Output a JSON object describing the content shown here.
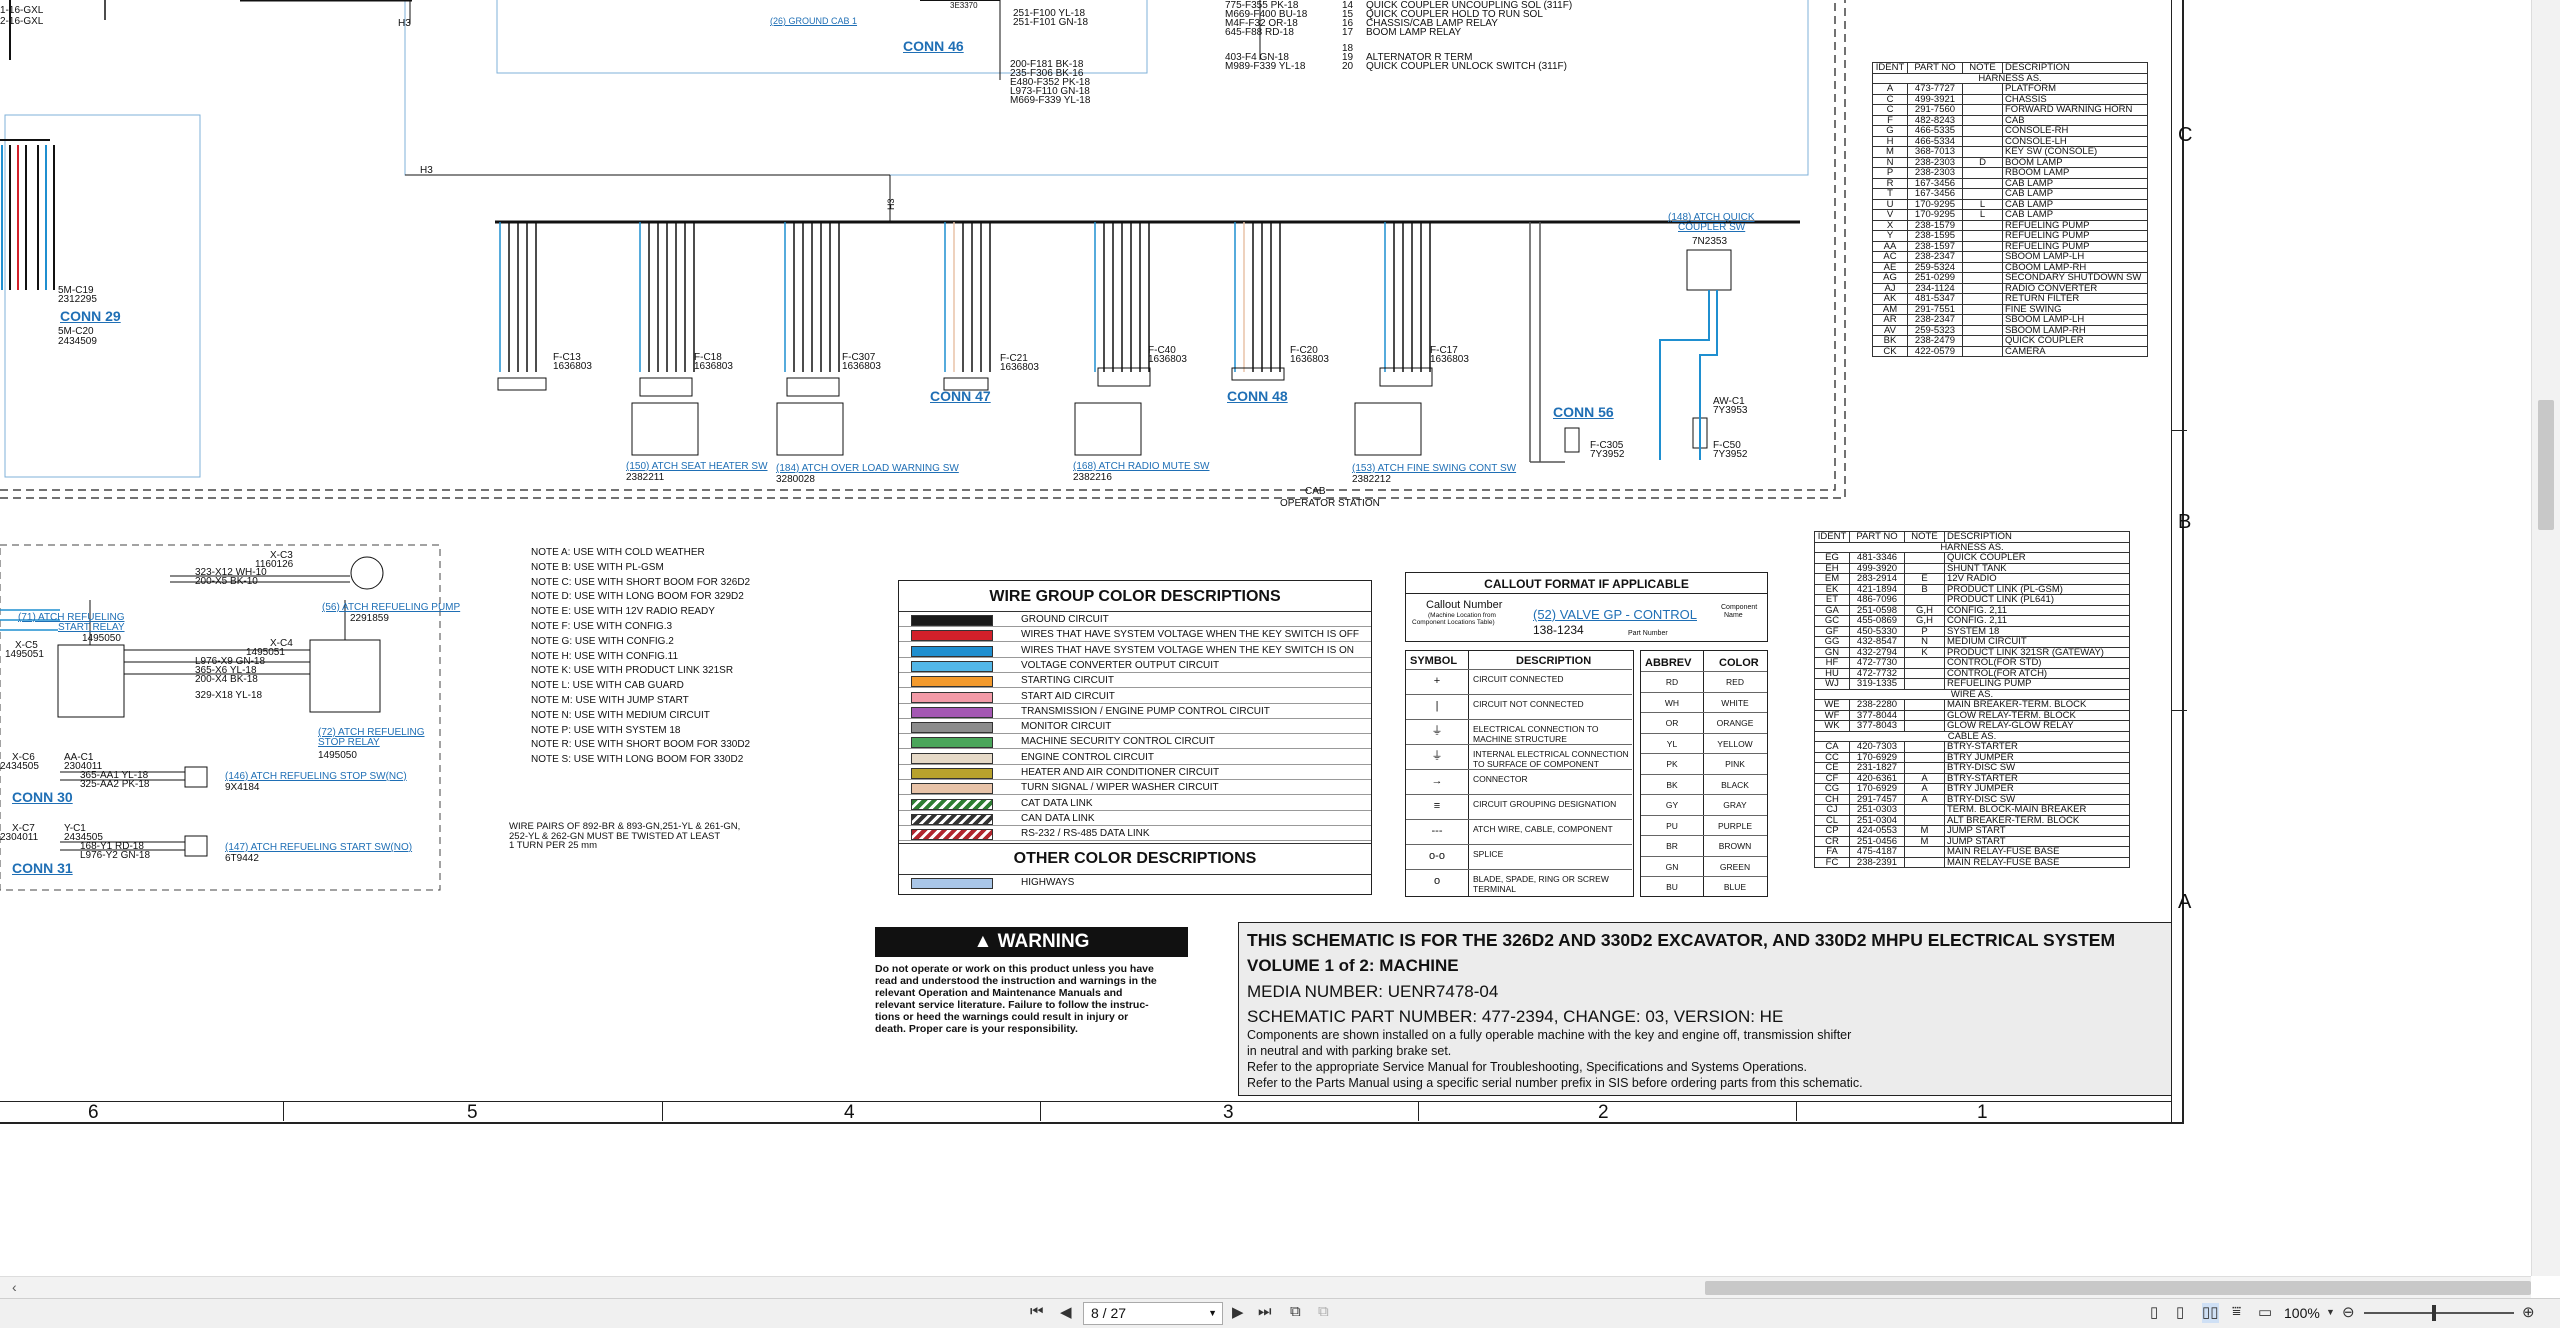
{
  "viewer": {
    "page_current": "8 / 27",
    "zoom": "100%"
  },
  "schematic": {
    "section_labels": [
      "C",
      "B",
      "A"
    ],
    "column_numbers": [
      "6",
      "5",
      "4",
      "3",
      "2",
      "1"
    ],
    "top_fragments": {
      "left1": "1-16-GXL",
      "left2": "2-16-GXL",
      "ground_cab": "(26) GROUND CAB 1",
      "conn46": "CONN 46",
      "h3a": "H3",
      "h3b": "H3",
      "h3c": "H3",
      "c46_wires": [
        "251-F100 YL-18",
        "251-F101 GN-18",
        "200-F181 BK-18",
        "235-F306 BK-16",
        "E480-F352 PK-18",
        "L973-F110 GN-18",
        "M669-F339 YL-18"
      ],
      "c46_id": "3E3370",
      "relay_lines": [
        "QUICK COUPLER UNCOUPLING SOL (311F)",
        "QUICK COUPLER HOLD TO RUN SOL",
        "CHASSIS/CAB LAMP RELAY",
        "BOOM LAMP RELAY",
        "ALTERNATOR R TERM",
        "QUICK COUPLER UNLOCK SWITCH (311F)"
      ],
      "relay_wires": [
        "775-F355 PK-18",
        "M669-F400 BU-18",
        "M4F-F32 OR-18",
        "645-F88 RD-18",
        "403-F4 GN-18",
        "M989-F339 YL-18"
      ],
      "relay_pins": [
        "14",
        "15",
        "16",
        "17",
        "18",
        "19",
        "20"
      ]
    },
    "conns": [
      {
        "label": "CONN 29",
        "fc": "5M-C19",
        "part": "2312295",
        "part2": "5M-C20",
        "part3": "2434509"
      },
      {
        "label": "CONN 47"
      },
      {
        "label": "CONN 48"
      },
      {
        "label": "CONN 56"
      },
      {
        "label": "CONN 30"
      },
      {
        "label": "CONN 31"
      }
    ],
    "switches": [
      {
        "link": "(150) ATCH SEAT HEATER SW",
        "part": "2382211",
        "fc": "F-C18",
        "fcp": "1636803",
        "fc2": "F-C13",
        "fc2p": "1636803"
      },
      {
        "link": "(184) ATCH OVER LOAD WARNING SW",
        "part": "3280028",
        "fc": "F-C307",
        "fcp": "1636803"
      },
      {
        "link": "(168) ATCH RADIO MUTE SW",
        "part": "2382216",
        "fc": "F-C40",
        "fcp": "1636803",
        "fc2": "F-C21",
        "fc2p": "1636803"
      },
      {
        "link": "(153) ATCH FINE SWING CONT SW",
        "part": "2382212",
        "fc": "F-C17",
        "fcp": "1636803",
        "fc2": "F-C20",
        "fc2p": "1636803"
      }
    ],
    "quick_coupler": {
      "link1": "(148) ATCH QUICK",
      "link2": "COUPLER SW",
      "part": "7N2353",
      "awc1": "AW-C1",
      "awc1p": "7Y3953",
      "fc50": "F-C50",
      "fc50p": "7Y3952",
      "fc305": "F-C305",
      "fc305p": "7Y3952"
    },
    "cab_label1": "CAB",
    "cab_label2": "OPERATOR STATION",
    "left_components": {
      "xc3": "X-C3",
      "xc3p": "1160126",
      "w1": "323-X12 WH-10",
      "w2": "200-X5 BK-10",
      "pump_link": "(56) ATCH REFUELING PUMP",
      "pump_part": "2291859",
      "relay_link1": "(71) ATCH REFUELING",
      "relay_link2": "START RELAY",
      "relay_part": "1495050",
      "xc5": "X-C5",
      "xc5p": "1495051",
      "xc4": "X-C4",
      "xc4p": "1495051",
      "w3": "L976-X9 GN-18",
      "w4": "365-X6 YL-18",
      "w5": "200-X4 BK-18",
      "w6": "329-X18 YL-18",
      "stop_link1": "(72) ATCH REFUELING",
      "stop_link2": "STOP RELAY",
      "stop_part": "1495050",
      "xc6": "X-C6",
      "xc6p": "2434505",
      "ac1": "AA-C1",
      "ac1p": "2304011",
      "w7": "365-AA1 YL-18",
      "w8": "325-AA2 PK-18",
      "stop_sw": "(146) ATCH REFUELING STOP SW(NC)",
      "stop_sw_part": "9X4184",
      "xc7": "X-C7",
      "xc7p": "2304011",
      "yc1": "Y-C1",
      "yc1p": "2434505",
      "w9": "168-Y1 RD-18",
      "w10": "L976-Y2 GN-18",
      "start_sw": "(147) ATCH REFUELING START SW(NO)",
      "start_sw_part": "6T9442"
    },
    "notes": [
      "NOTE A: USE WITH COLD WEATHER",
      "NOTE B: USE WITH PL-GSM",
      "NOTE C: USE WITH SHORT BOOM FOR 326D2",
      "NOTE D: USE WITH LONG BOOM FOR 329D2",
      "NOTE E: USE WITH 12V RADIO READY",
      "NOTE F: USE WITH CONFIG.3",
      "NOTE G: USE WITH CONFIG.2",
      "NOTE H: USE WITH CONFIG.11",
      "NOTE K: USE WITH PRODUCT LINK 321SR",
      "NOTE L: USE WITH CAB GUARD",
      "NOTE M: USE WITH JUMP START",
      "NOTE N: USE WITH MEDIUM CIRCUIT",
      "NOTE P: USE WITH SYSTEM 18",
      "NOTE R: USE WITH SHORT BOOM FOR 330D2",
      "NOTE S: USE WITH LONG BOOM FOR 330D2"
    ],
    "twist_note": [
      "WIRE PAIRS OF 892-BR & 893-GN,251-YL & 261-GN,",
      "252-YL & 262-GN MUST BE TWISTED AT LEAST",
      "1 TURN PER 25 mm"
    ],
    "wire_group": {
      "title": "WIRE GROUP COLOR DESCRIPTIONS",
      "rows": [
        {
          "label": "GROUND CIRCUIT",
          "color": "#1a1a1a"
        },
        {
          "label": "WIRES THAT HAVE SYSTEM VOLTAGE WHEN THE KEY SWITCH IS OFF",
          "color": "#d2202a"
        },
        {
          "label": "WIRES THAT HAVE SYSTEM VOLTAGE WHEN THE KEY SWITCH IS ON",
          "color": "#1f8fd0"
        },
        {
          "label": "VOLTAGE CONVERTER OUTPUT CIRCUIT",
          "color": "#53b7e8"
        },
        {
          "label": "STARTING CIRCUIT",
          "color": "#f39a2d"
        },
        {
          "label": "START AID CIRCUIT",
          "color": "#f29aa7"
        },
        {
          "label": "TRANSMISSION / ENGINE PUMP CONTROL CIRCUIT",
          "color": "#a457b3"
        },
        {
          "label": "MONITOR CIRCUIT",
          "color": "#8c8c8c"
        },
        {
          "label": "MACHINE SECURITY CONTROL CIRCUIT",
          "color": "#4aa65a"
        },
        {
          "label": "ENGINE CONTROL CIRCUIT",
          "color": "#e5d9c7"
        },
        {
          "label": "HEATER AND AIR CONDITIONER CIRCUIT",
          "color": "#b8a22c"
        },
        {
          "label": "TURN SIGNAL / WIPER WASHER CIRCUIT",
          "color": "#e8c3a8"
        },
        {
          "label": "CAT DATA LINK",
          "color": "#2e7d32"
        },
        {
          "label": "CAN DATA LINK",
          "color": "#333333"
        },
        {
          "label": "RS-232 / RS-485 DATA LINK",
          "color": "#b0262e"
        }
      ],
      "other_title": "OTHER COLOR DESCRIPTIONS",
      "other_rows": [
        {
          "label": "HIGHWAYS",
          "color": "#a9c6e8"
        }
      ]
    },
    "callout": {
      "title": "CALLOUT FORMAT IF APPLICABLE",
      "num_label": "Callout Number",
      "num_sub1": "(Machine Location from",
      "num_sub2": "Component Locations Table)",
      "example": "(52) VALVE GP - CONTROL",
      "comp_name": "Component",
      "comp_name2": "Name",
      "part_example": "138-1234",
      "part_label": "Part Number"
    },
    "symbols": {
      "h1": "SYMBOL",
      "h2": "DESCRIPTION",
      "rows": [
        {
          "sym": "+",
          "desc": "CIRCUIT CONNECTED"
        },
        {
          "sym": "|",
          "desc": "CIRCUIT NOT CONNECTED"
        },
        {
          "sym": "⏚",
          "desc": "ELECTRICAL CONNECTION TO MACHINE STRUCTURE"
        },
        {
          "sym": "⏚",
          "desc": "INTERNAL ELECTRICAL CONNECTION TO SURFACE OF COMPONENT"
        },
        {
          "sym": "→",
          "desc": "CONNECTOR"
        },
        {
          "sym": "≡",
          "desc": "CIRCUIT GROUPING DESIGNATION"
        },
        {
          "sym": "---",
          "desc": "ATCH WIRE, CABLE, COMPONENT"
        },
        {
          "sym": "o-o",
          "desc": "SPLICE"
        },
        {
          "sym": "o",
          "desc": "BLADE, SPADE, RING OR SCREW TERMINAL"
        }
      ]
    },
    "colors": {
      "h1": "ABBREV",
      "h2": "COLOR",
      "rows": [
        [
          "RD",
          "RED"
        ],
        [
          "WH",
          "WHITE"
        ],
        [
          "OR",
          "ORANGE"
        ],
        [
          "YL",
          "YELLOW"
        ],
        [
          "PK",
          "PINK"
        ],
        [
          "BK",
          "BLACK"
        ],
        [
          "GY",
          "GRAY"
        ],
        [
          "PU",
          "PURPLE"
        ],
        [
          "BR",
          "BROWN"
        ],
        [
          "GN",
          "GREEN"
        ],
        [
          "BU",
          "BLUE"
        ]
      ]
    },
    "warning": {
      "title": "WARNING",
      "text": [
        "Do not operate or work on this product unless you have",
        "read and understood the instruction and warnings in the",
        "relevant Operation and Maintenance Manuals and",
        "relevant service literature. Failure to follow the instruc-",
        "tions or heed the warnings could result in injury or",
        "death. Proper care is your responsibility."
      ]
    },
    "title_block": {
      "line1": "THIS SCHEMATIC IS FOR THE 326D2 AND 330D2 EXCAVATOR, AND 330D2 MHPU ELECTRICAL SYSTEM",
      "line2": "VOLUME 1 of 2: MACHINE",
      "line3": "MEDIA NUMBER: UENR7478-04",
      "line4": "SCHEMATIC PART NUMBER: 477-2394, CHANGE: 03, VERSION: HE",
      "line5": "Components are shown installed on a fully operable machine with the key and engine off, transmission shifter",
      "line6": "in neutral and with parking brake set.",
      "line7": "Refer to the appropriate Service Manual for Troubleshooting, Specifications and Systems Operations.",
      "line8": "Refer to the Parts Manual using a specific serial number prefix in SIS before ordering parts from this schematic."
    },
    "parts_table_top": {
      "headers": [
        "IDENT",
        "PART NO",
        "NOTE",
        "DESCRIPTION"
      ],
      "sections": [
        {
          "title": "HARNESS AS.",
          "rows": [
            [
              "A",
              "473-7727",
              "",
              "PLATFORM"
            ],
            [
              "C",
              "499-3921",
              "",
              "CHASSIS"
            ],
            [
              "C",
              "291-7560",
              "",
              "FORWARD WARNING HORN"
            ],
            [
              "F",
              "482-8243",
              "",
              "CAB"
            ],
            [
              "G",
              "466-5335",
              "",
              "CONSOLE-RH"
            ],
            [
              "H",
              "466-5334",
              "",
              "CONSOLE-LH"
            ],
            [
              "M",
              "368-7013",
              "",
              "KEY SW (CONSOLE)"
            ],
            [
              "N",
              "238-2303",
              "D",
              "BOOM LAMP"
            ],
            [
              "P",
              "238-2303",
              "",
              "RBOOM LAMP"
            ],
            [
              "R",
              "167-3456",
              "",
              "CAB LAMP"
            ],
            [
              "T",
              "167-3456",
              "",
              "CAB LAMP"
            ],
            [
              "U",
              "170-9295",
              "L",
              "CAB LAMP"
            ],
            [
              "V",
              "170-9295",
              "L",
              "CAB LAMP"
            ],
            [
              "X",
              "238-1579",
              "",
              "REFUELING PUMP"
            ],
            [
              "Y",
              "238-1595",
              "",
              "REFUELING PUMP"
            ],
            [
              "AA",
              "238-1597",
              "",
              "REFUELING PUMP"
            ],
            [
              "AC",
              "238-2347",
              "",
              "SBOOM LAMP-LH"
            ],
            [
              "AE",
              "259-5324",
              "",
              "CBOOM LAMP-RH"
            ],
            [
              "AG",
              "251-0299",
              "",
              "SECONDARY SHUTDOWN SW"
            ],
            [
              "AJ",
              "234-1124",
              "",
              "RADIO CONVERTER"
            ],
            [
              "AK",
              "481-5347",
              "",
              "RETURN FILTER"
            ],
            [
              "AM",
              "291-7551",
              "",
              "FINE SWING"
            ],
            [
              "AR",
              "238-2347",
              "",
              "SBOOM LAMP-LH"
            ],
            [
              "AV",
              "259-5323",
              "",
              "SBOOM LAMP-RH"
            ],
            [
              "BK",
              "238-2479",
              "",
              "QUICK COUPLER"
            ],
            [
              "CK",
              "422-0579",
              "",
              "CAMERA"
            ]
          ]
        }
      ]
    },
    "parts_table_bottom": {
      "headers": [
        "IDENT",
        "PART NO",
        "NOTE",
        "DESCRIPTION"
      ],
      "sections": [
        {
          "title": "HARNESS AS.",
          "rows": [
            [
              "EG",
              "481-3346",
              "",
              "QUICK COUPLER"
            ],
            [
              "EH",
              "499-3920",
              "",
              "SHUNT TANK"
            ],
            [
              "EM",
              "283-2914",
              "E",
              "12V RADIO"
            ],
            [
              "EK",
              "421-1894",
              "B",
              "PRODUCT LINK (PL-GSM)"
            ],
            [
              "ET",
              "486-7096",
              "",
              "PRODUCT LINK (PL641)"
            ],
            [
              "GA",
              "251-0598",
              "G,H",
              "CONFIG. 2,11"
            ],
            [
              "GC",
              "455-0869",
              "G,H",
              "CONFIG. 2,11"
            ],
            [
              "GF",
              "450-5330",
              "P",
              "SYSTEM 18"
            ],
            [
              "GG",
              "432-8547",
              "N",
              "MEDIUM CIRCUIT"
            ],
            [
              "GN",
              "432-2794",
              "K",
              "PRODUCT LINK 321SR (GATEWAY)"
            ],
            [
              "HF",
              "472-7730",
              "",
              "CONTROL(FOR STD)"
            ],
            [
              "HU",
              "472-7732",
              "",
              "CONTROL(FOR ATCH)"
            ],
            [
              "WJ",
              "319-1335",
              "",
              "REFUELING PUMP"
            ]
          ]
        },
        {
          "title": "WIRE AS.",
          "rows": [
            [
              "WE",
              "238-2280",
              "",
              "MAIN BREAKER-TERM. BLOCK"
            ],
            [
              "WF",
              "377-8044",
              "",
              "GLOW RELAY-TERM. BLOCK"
            ],
            [
              "WK",
              "377-8043",
              "",
              "GLOW RELAY-GLOW RELAY"
            ]
          ]
        },
        {
          "title": "CABLE AS.",
          "rows": [
            [
              "CA",
              "420-7303",
              "",
              "BTRY-STARTER"
            ],
            [
              "CC",
              "170-6929",
              "",
              "BTRY JUMPER"
            ],
            [
              "CE",
              "231-1827",
              "",
              "BTRY-DISC SW"
            ],
            [
              "CF",
              "420-6361",
              "A",
              "BTRY-STARTER"
            ],
            [
              "CG",
              "170-6929",
              "A",
              "BTRY JUMPER"
            ],
            [
              "CH",
              "291-7457",
              "A",
              "BTRY-DISC SW"
            ],
            [
              "CJ",
              "251-0303",
              "",
              "TERM. BLOCK-MAIN BREAKER"
            ],
            [
              "CL",
              "251-0304",
              "",
              "ALT BREAKER-TERM. BLOCK"
            ],
            [
              "CP",
              "424-0553",
              "M",
              "JUMP START"
            ],
            [
              "CR",
              "251-0456",
              "M",
              "JUMP START"
            ],
            [
              "FA",
              "475-4187",
              "",
              "MAIN RELAY-FUSE BASE"
            ],
            [
              "FC",
              "238-2391",
              "",
              "MAIN RELAY-FUSE BASE"
            ]
          ]
        }
      ]
    }
  }
}
